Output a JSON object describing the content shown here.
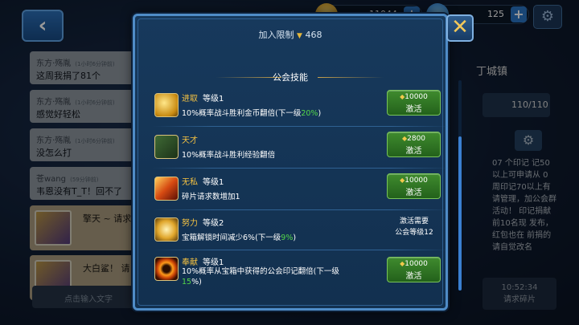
{
  "header": {
    "gold_value": "11044",
    "gem_value": "125"
  },
  "chat": {
    "messages": [
      {
        "name": "东方·殇胤",
        "time": "(1小时6分钟前)",
        "text": "这周我捐了81个"
      },
      {
        "name": "东方·殇胤",
        "time": "(1小时6分钟前)",
        "text": "感觉好轻松"
      },
      {
        "name": "东方·殇胤",
        "time": "(1小时6分钟前)",
        "text": "没怎么打"
      },
      {
        "name": "苍wang",
        "time": "(59分钟前)",
        "text": "韦恩没有T_T！回不了"
      }
    ],
    "cards": [
      {
        "text": "擎天 ~ 请求"
      },
      {
        "text": "大白鲨！ 请"
      }
    ],
    "input_placeholder": "点击输入文字"
  },
  "right_panel": {
    "town_name": "丁城镇",
    "members": "110/110",
    "description": "07 个印记 记50以上可申请从 0 周印记70以上有 请管理，加公会群 活动！ 印记捐献前10名现 发布，红包也在 前捐的请自觉改名",
    "timer": "10:52:34",
    "timer_label": "请求碎片"
  },
  "modal": {
    "join_limit_label": "加入限制",
    "join_limit_value": "468",
    "section_title": "公会技能",
    "skills": [
      {
        "icon": "gold-coin-icon",
        "name": "进取",
        "level": "等级1",
        "desc_prefix": "10%概率战斗胜利金币翻倍(下一级",
        "desc_next": "20%",
        "desc_suffix": ")",
        "action": {
          "type": "button",
          "cost": "10000",
          "label": "激活"
        }
      },
      {
        "icon": "talent-book-icon",
        "name": "天才",
        "level": "",
        "desc_prefix": "10%概率战斗胜利经验翻倍",
        "desc_next": "",
        "desc_suffix": "",
        "action": {
          "type": "button",
          "cost": "2800",
          "label": "激活"
        }
      },
      {
        "icon": "selfless-fire-icon",
        "name": "无私",
        "level": "等级1",
        "desc_prefix": "碎片请求数增加1",
        "desc_next": "",
        "desc_suffix": "",
        "action": {
          "type": "button",
          "cost": "10000",
          "label": "激活"
        }
      },
      {
        "icon": "clock-icon",
        "name": "努力",
        "level": "等级2",
        "desc_prefix": "宝箱解锁时间减少6%(下一级",
        "desc_next": "9%",
        "desc_suffix": ")",
        "action": {
          "type": "requirement",
          "line1": "激活需要",
          "line2": "公会等级12"
        }
      },
      {
        "icon": "dedication-ring-icon",
        "name": "奉献",
        "level": "等级1",
        "desc_prefix": "10%概率从宝箱中获得的公会印记翻倍(下一级",
        "desc_next": "15",
        "desc_suffix": "%)",
        "action": {
          "type": "button",
          "cost": "10000",
          "label": "激活"
        }
      }
    ]
  }
}
